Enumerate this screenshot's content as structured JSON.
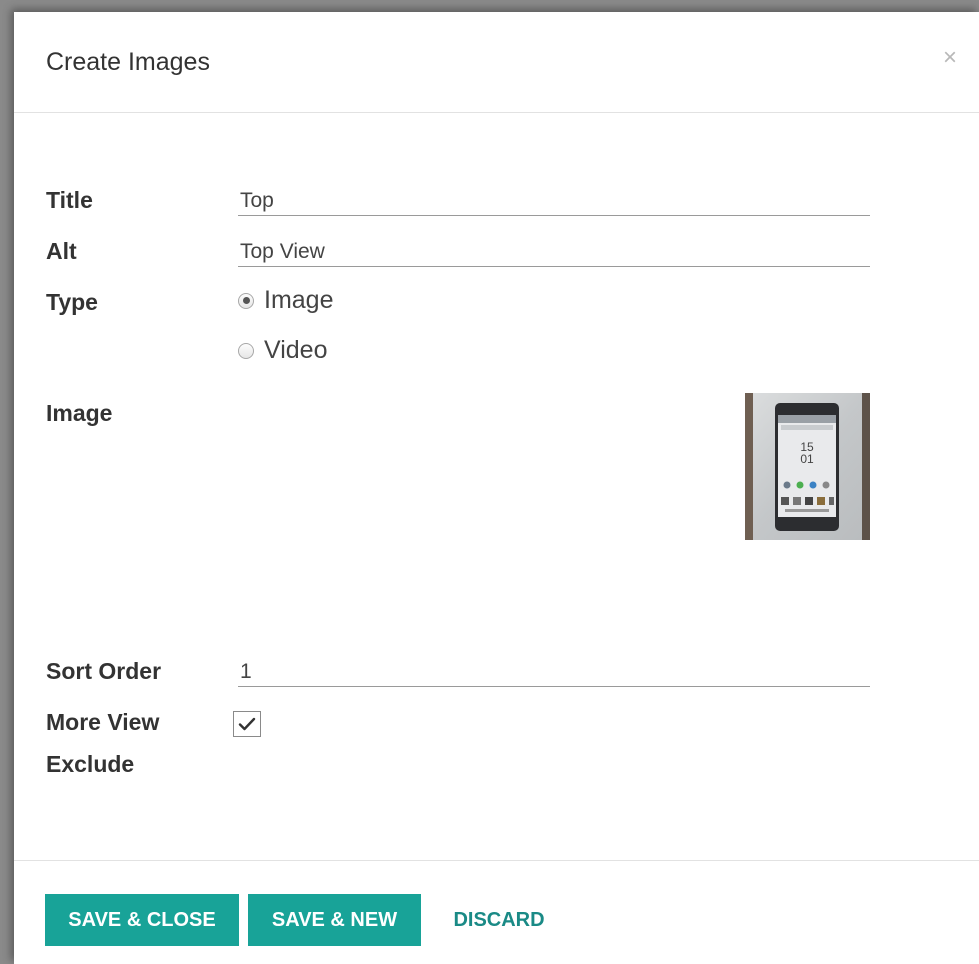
{
  "dialog": {
    "title": "Create Images",
    "close_glyph": "×"
  },
  "form": {
    "title_label": "Title",
    "title_value": "Top",
    "alt_label": "Alt",
    "alt_value": "Top View",
    "type_label": "Type",
    "type_options": [
      {
        "label": "Image",
        "selected": true
      },
      {
        "label": "Video",
        "selected": false
      }
    ],
    "image_label": "Image",
    "image_thumbnail": {
      "icon": "phone-photo-thumbnail",
      "clock_hour": "15",
      "clock_minute": "01"
    },
    "sort_order_label": "Sort Order",
    "sort_order_value": "1",
    "more_view_exclude_label_line1": "More View",
    "more_view_exclude_label_line2": "Exclude",
    "more_view_exclude_checked": true
  },
  "footer": {
    "save_close_label": "SAVE & CLOSE",
    "save_new_label": "SAVE & NEW",
    "discard_label": "DISCARD"
  },
  "colors": {
    "primary": "#18a398",
    "link": "#1a8a86",
    "text": "#333333"
  }
}
